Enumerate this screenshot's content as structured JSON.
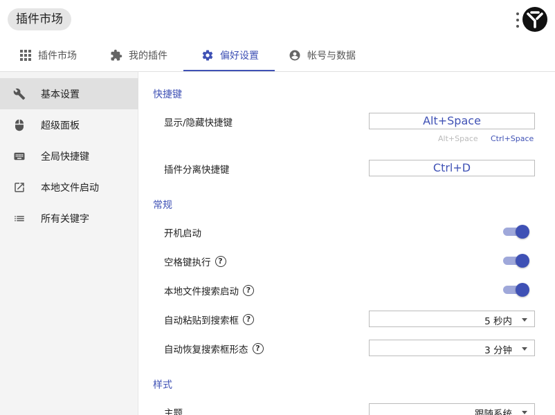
{
  "header": {
    "app_title": "插件市场"
  },
  "tabs": [
    {
      "label": "插件市场",
      "icon": "grid-icon"
    },
    {
      "label": "我的插件",
      "icon": "puzzle-icon"
    },
    {
      "label": "偏好设置",
      "icon": "gear-icon",
      "active": true
    },
    {
      "label": "帐号与数据",
      "icon": "account-icon"
    }
  ],
  "sidebar": {
    "items": [
      {
        "label": "基本设置",
        "icon": "wrench-icon",
        "active": true
      },
      {
        "label": "超级面板",
        "icon": "mouse-icon"
      },
      {
        "label": "全局快捷键",
        "icon": "keyboard-icon"
      },
      {
        "label": "本地文件启动",
        "icon": "open-external-icon"
      },
      {
        "label": "所有关键字",
        "icon": "list-icon"
      }
    ]
  },
  "main": {
    "hotkeys": {
      "title": "快捷键",
      "show_hide_label": "显示/隐藏快捷键",
      "show_hide_value": "Alt+Space",
      "hint_1": "Alt+Space",
      "hint_2": "Ctrl+Space",
      "detach_label": "插件分离快捷键",
      "detach_value": "Ctrl+D"
    },
    "general": {
      "title": "常规",
      "autostart_label": "开机启动",
      "autostart_on": true,
      "space_exec_label": "空格键执行",
      "space_exec_on": true,
      "local_search_label": "本地文件搜索启动",
      "local_search_on": true,
      "auto_paste_label": "自动粘贴到搜索框",
      "auto_paste_value": "5 秒内",
      "auto_restore_label": "自动恢复搜索框形态",
      "auto_restore_value": "3 分钟"
    },
    "style": {
      "title": "样式",
      "theme_label": "主题",
      "theme_value": "跟随系统"
    }
  },
  "colors": {
    "accent": "#3f51b5",
    "accent_light": "#9fa8da",
    "sidebar_bg": "#f4f4f4",
    "active_item_bg": "#e0e0e0"
  }
}
